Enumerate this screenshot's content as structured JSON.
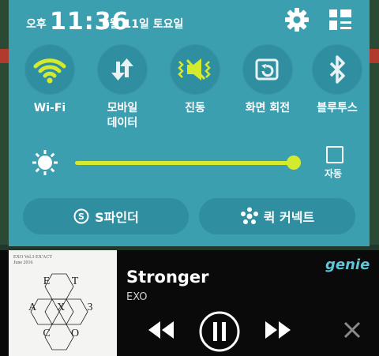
{
  "status": {
    "ampm": "오후",
    "time": "11:36",
    "date": "6월 11일 토요일"
  },
  "toggles": [
    {
      "label": "Wi-Fi",
      "icon": "wifi-icon",
      "active": true
    },
    {
      "label": "모바일\n데이터",
      "icon": "mobile-data-icon",
      "active": false
    },
    {
      "label": "진동",
      "icon": "vibrate-icon",
      "active": true
    },
    {
      "label": "화면 회전",
      "icon": "screen-rotation-icon",
      "active": false
    },
    {
      "label": "블루투스",
      "icon": "bluetooth-icon",
      "active": false
    }
  ],
  "brightness": {
    "level": 0.97,
    "auto_label": "자동",
    "auto_checked": false
  },
  "buttons": {
    "sfinder": "S파인더",
    "quick_connect": "퀵 커넥트"
  },
  "player": {
    "title": "Stronger",
    "artist": "EXO",
    "app": "genie",
    "album_caption_1": "EXO Vol.3 EX'ACT",
    "album_caption_2": "June 2016",
    "album_letters": [
      "E",
      "T",
      "A",
      "X",
      "3",
      "C",
      "O"
    ]
  },
  "colors": {
    "panel_bg": "#3b9fb0",
    "toggle_bg": "#2f8fa0",
    "accent_active": "#d4ea2c",
    "player_bg": "#0a0a0a"
  }
}
